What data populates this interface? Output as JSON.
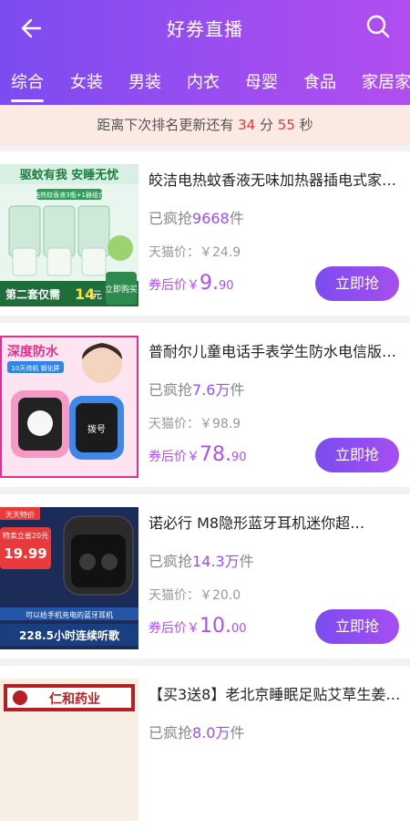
{
  "header": {
    "title": "好券直播",
    "back_icon": "arrow-left-icon",
    "search_icon": "search-icon"
  },
  "tabs": [
    {
      "label": "综合",
      "active": true
    },
    {
      "label": "女装",
      "active": false
    },
    {
      "label": "男装",
      "active": false
    },
    {
      "label": "内衣",
      "active": false
    },
    {
      "label": "母婴",
      "active": false
    },
    {
      "label": "食品",
      "active": false
    },
    {
      "label": "家居家",
      "active": false
    }
  ],
  "countdown": {
    "prefix": "距离下次排名更新还有",
    "minutes": "34",
    "minute_unit": "分",
    "seconds": "55",
    "second_unit": "秒"
  },
  "products": [
    {
      "name": "皎洁电热蚊香液无味加热器插电式家…",
      "sold_prefix": "已疯抢",
      "sold_count": "9668",
      "sold_unit": "件",
      "tmall_price": "天猫价：￥24.9",
      "after_label": "券后价",
      "after_currency": "￥",
      "after_int": "9.",
      "after_dec": "90",
      "buy_label": "立即抢",
      "thumb_text": {
        "top": "驱蚊有我 安睡无忧",
        "sub": "电热蚊香液3瓶+1器组合",
        "bottom": "第二套仅需",
        "price": "14",
        "unit": "元",
        "badge": "立即购买"
      }
    },
    {
      "name": "普耐尔儿童电话手表学生防水电信版…",
      "sold_prefix": "已疯抢",
      "sold_count": "7.6万",
      "sold_unit": "件",
      "tmall_price": "天猫价：￥98.9",
      "after_label": "券后价",
      "after_currency": "￥",
      "after_int": "78.",
      "after_dec": "90",
      "buy_label": "立即抢",
      "thumb_text": {
        "top": "深度防水",
        "sub": "10天待机 钢化屏",
        "watch": "拨号"
      }
    },
    {
      "name": "诺必行 M8隐形蓝牙耳机迷你超…",
      "sold_prefix": "已疯抢",
      "sold_count": "14.3万",
      "sold_unit": "件",
      "tmall_price": "天猫价：￥20.0",
      "after_label": "券后价",
      "after_currency": "￥",
      "after_int": "10.",
      "after_dec": "00",
      "buy_label": "立即抢",
      "thumb_text": {
        "tag": "天天特价",
        "deal": "特卖立省20元",
        "price": "19.99",
        "caption": "可以给手机充电的蓝牙耳机",
        "hours": "228.5小时连续听歌"
      }
    },
    {
      "name": "【买3送8】老北京睡眠足贴艾草生姜…",
      "sold_prefix": "已疯抢",
      "sold_count": "8.0万",
      "sold_unit": "件",
      "tmall_price": "",
      "after_label": "",
      "after_currency": "",
      "after_int": "",
      "after_dec": "",
      "buy_label": "",
      "thumb_text": {
        "brand": "仁和药业"
      }
    }
  ]
}
